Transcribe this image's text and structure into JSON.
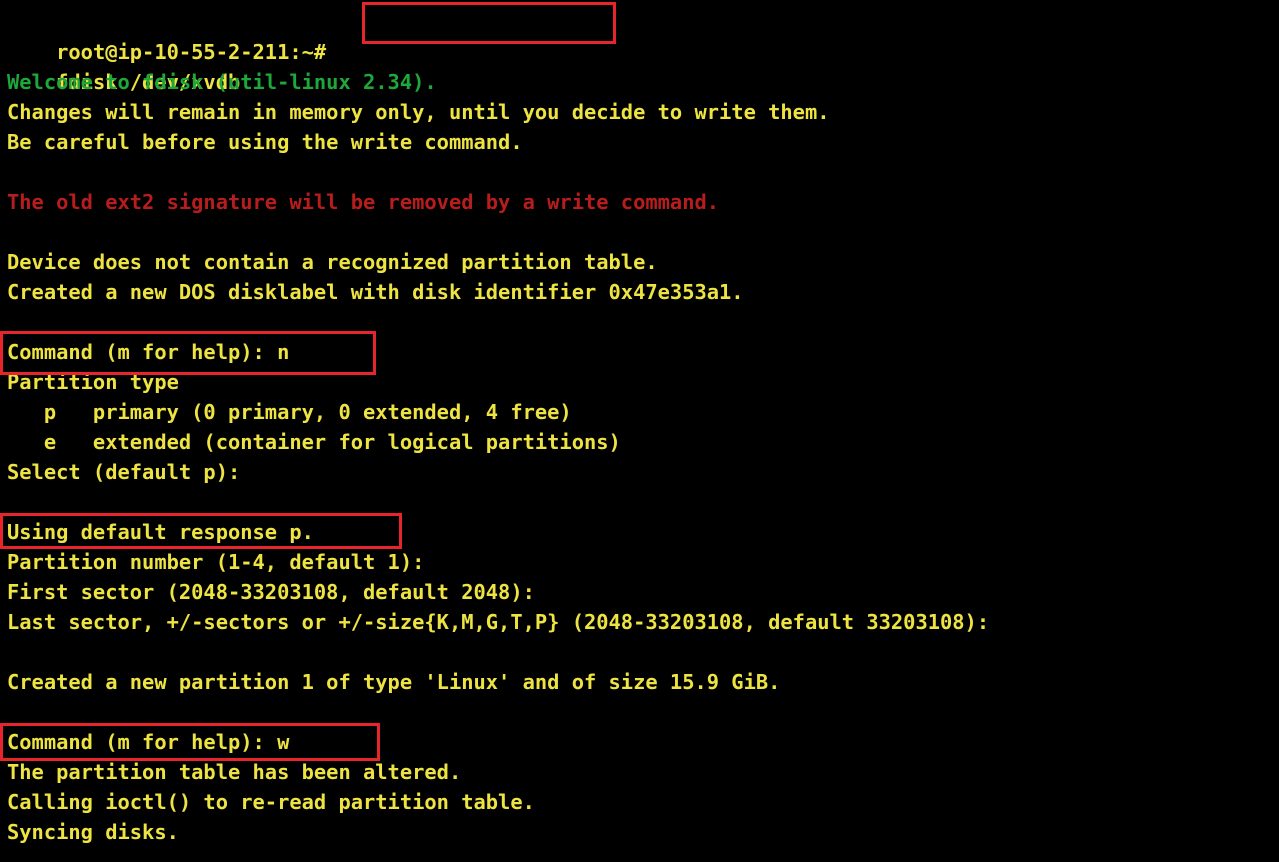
{
  "terminal": {
    "colors": {
      "background": "#000000",
      "default_text": "#ede342",
      "info_text": "#1fa83a",
      "warning_text": "#b81d1d",
      "highlight_box": "#e8242c"
    },
    "prompt": "root@ip-10-55-2-211:~#",
    "command": "fdisk /dev/xvdb",
    "lines": [
      "Welcome to fdisk (util-linux 2.34).",
      "Changes will remain in memory only, until you decide to write them.",
      "Be careful before using the write command.",
      "The old ext2 signature will be removed by a write command.",
      "Device does not contain a recognized partition table.",
      "Created a new DOS disklabel with disk identifier 0x47e353a1.",
      "Command (m for help): n",
      "Partition type",
      "   p   primary (0 primary, 0 extended, 4 free)",
      "   e   extended (container for logical partitions)",
      "Select (default p):",
      "Using default response p.",
      "Partition number (1-4, default 1):",
      "First sector (2048-33203108, default 2048):",
      "Last sector, +/-sectors or +/-size{K,M,G,T,P} (2048-33203108, default 33203108):",
      "Created a new partition 1 of type 'Linux' and of size 15.9 GiB.",
      "Command (m for help): w",
      "The partition table has been altered.",
      "Calling ioctl() to re-read partition table.",
      "Syncing disks."
    ]
  }
}
